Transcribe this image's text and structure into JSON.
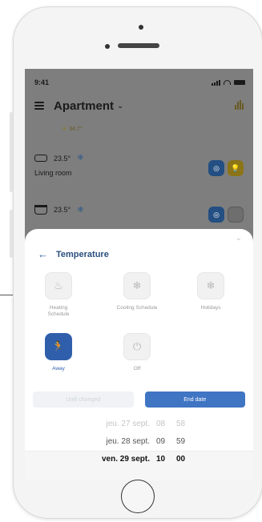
{
  "status_bar": {
    "time": "9:41"
  },
  "header": {
    "title": "Apartment",
    "chevron": "⌄",
    "outdoor_temp": "34.7°"
  },
  "rooms": [
    {
      "name": "Living room",
      "temp": "23.5°"
    },
    {
      "name": "",
      "temp": "23.5°"
    }
  ],
  "sheet": {
    "title": "Temperature",
    "modes": [
      {
        "label": "Heating Schedule",
        "icon": "flame-icon",
        "active": false
      },
      {
        "label": "Cooling Schedule",
        "icon": "snowflake-icon",
        "active": false
      },
      {
        "label": "Holidays",
        "icon": "snowflake-icon",
        "active": false
      },
      {
        "label": "Away",
        "icon": "running-person-icon",
        "active": true
      },
      {
        "label": "Off",
        "icon": "power-icon",
        "active": false
      }
    ],
    "buttons": {
      "left": "Until changed",
      "right": "End date"
    },
    "picker": [
      {
        "date": "jeu. 27 sept.",
        "hour": "08",
        "minute": "58"
      },
      {
        "date": "jeu. 28 sept.",
        "hour": "09",
        "minute": "59"
      },
      {
        "date": "ven. 29 sept.",
        "hour": "10",
        "minute": "00"
      }
    ]
  },
  "colors": {
    "accent": "#2f5fab",
    "button_blue": "#3f75c3",
    "overlay": "#7e7e7e"
  }
}
